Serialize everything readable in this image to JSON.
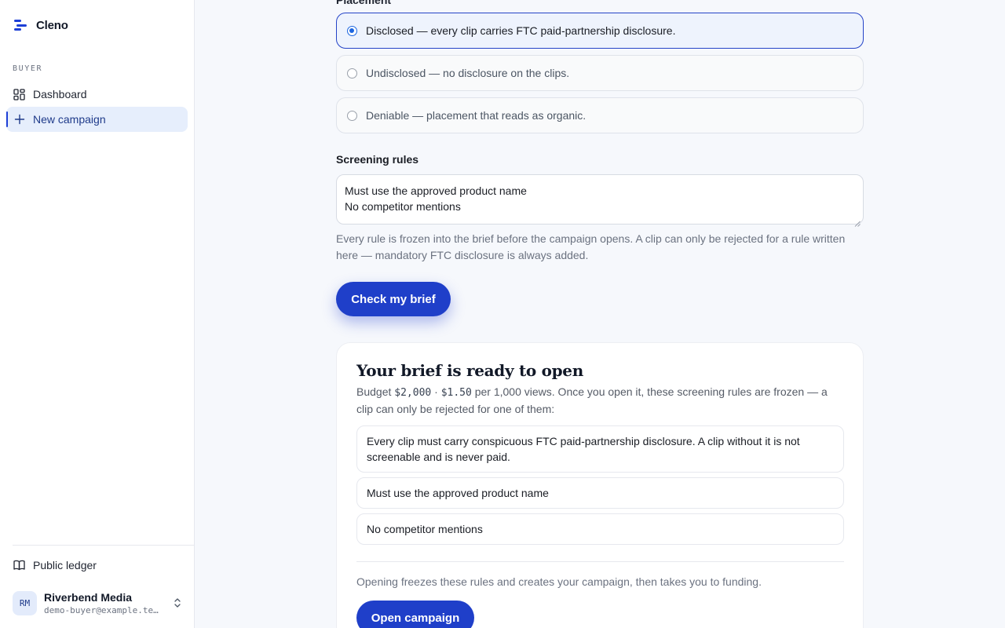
{
  "sidebar": {
    "brand": "Cleno",
    "section_label": "BUYER",
    "items": [
      {
        "label": "Dashboard",
        "icon": "dashboard-grid-icon"
      },
      {
        "label": "New campaign",
        "icon": "plus-icon",
        "active": true
      }
    ],
    "public_ledger": "Public ledger",
    "user": {
      "initials": "RM",
      "name": "Riverbend Media",
      "email": "demo-buyer@example.test"
    }
  },
  "placement": {
    "label": "Placement",
    "options": [
      {
        "label": "Disclosed — every clip carries FTC paid-partnership disclosure.",
        "selected": true
      },
      {
        "label": "Undisclosed — no disclosure on the clips.",
        "selected": false
      },
      {
        "label": "Deniable — placement that reads as organic.",
        "selected": false
      }
    ]
  },
  "screening": {
    "label": "Screening rules",
    "lines": [
      "Must use the approved product name",
      "No competitor mentions"
    ],
    "help": "Every rule is frozen into the brief before the campaign opens. A clip can only be rejected for a rule written here — mandatory FTC disclosure is always added."
  },
  "check_button": "Check my brief",
  "brief": {
    "title": "Your brief is ready to open",
    "desc_prefix": "Budget ",
    "budget": "$2,000",
    "sep": " · ",
    "rate": "$1.50",
    "desc_suffix": " per 1,000 views. Once you open it, these screening rules are frozen — a clip can only be rejected for one of them:",
    "rules": [
      "Every clip must carry conspicuous FTC paid-partnership disclosure. A clip without it is not screenable and is never paid.",
      "Must use the approved product name",
      "No competitor mentions"
    ],
    "footer": "Opening freezes these rules and creates your campaign, then takes you to funding.",
    "open_button": "Open campaign"
  },
  "colors": {
    "accent": "#1f3fc9",
    "selected_bg": "#eef3fd"
  }
}
